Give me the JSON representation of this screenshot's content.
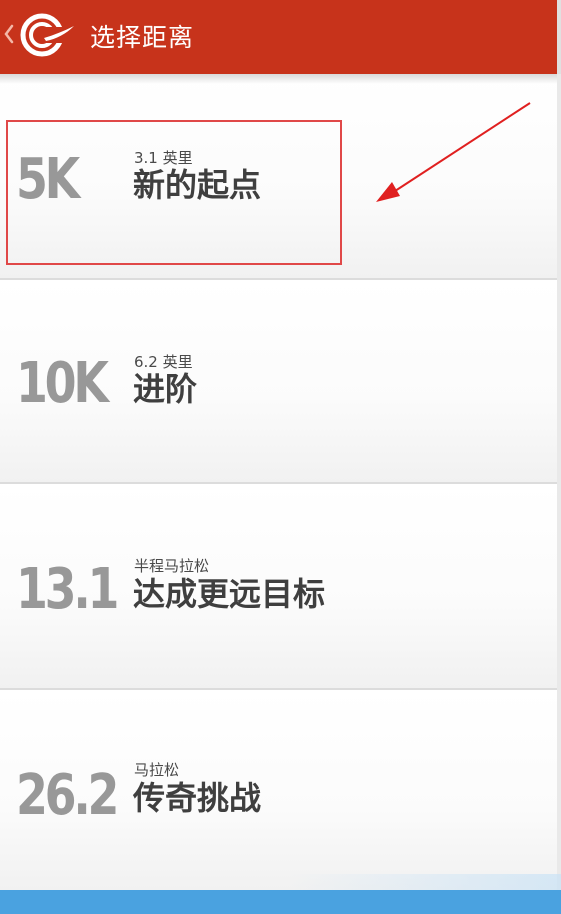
{
  "header": {
    "title": "选择距离",
    "back_icon": "chevron-left-icon",
    "logo_icon": "app-logo-icon",
    "background": "#c7331b"
  },
  "distances": [
    {
      "distance": "5K",
      "subtitle": "3.1 英里",
      "title": "新的起点"
    },
    {
      "distance": "10K",
      "subtitle": "6.2 英里",
      "title": "进阶"
    },
    {
      "distance": "13.1",
      "subtitle": "半程马拉松",
      "title": "达成更远目标"
    },
    {
      "distance": "26.2",
      "subtitle": "马拉松",
      "title": "传奇挑战"
    }
  ],
  "annotation": {
    "highlight_color": "#e04848",
    "arrow_color": "#e02020"
  },
  "colors": {
    "distance_text": "#989898",
    "title_text": "#3f3f3f",
    "bottom_bar": "#4aa2e0"
  }
}
